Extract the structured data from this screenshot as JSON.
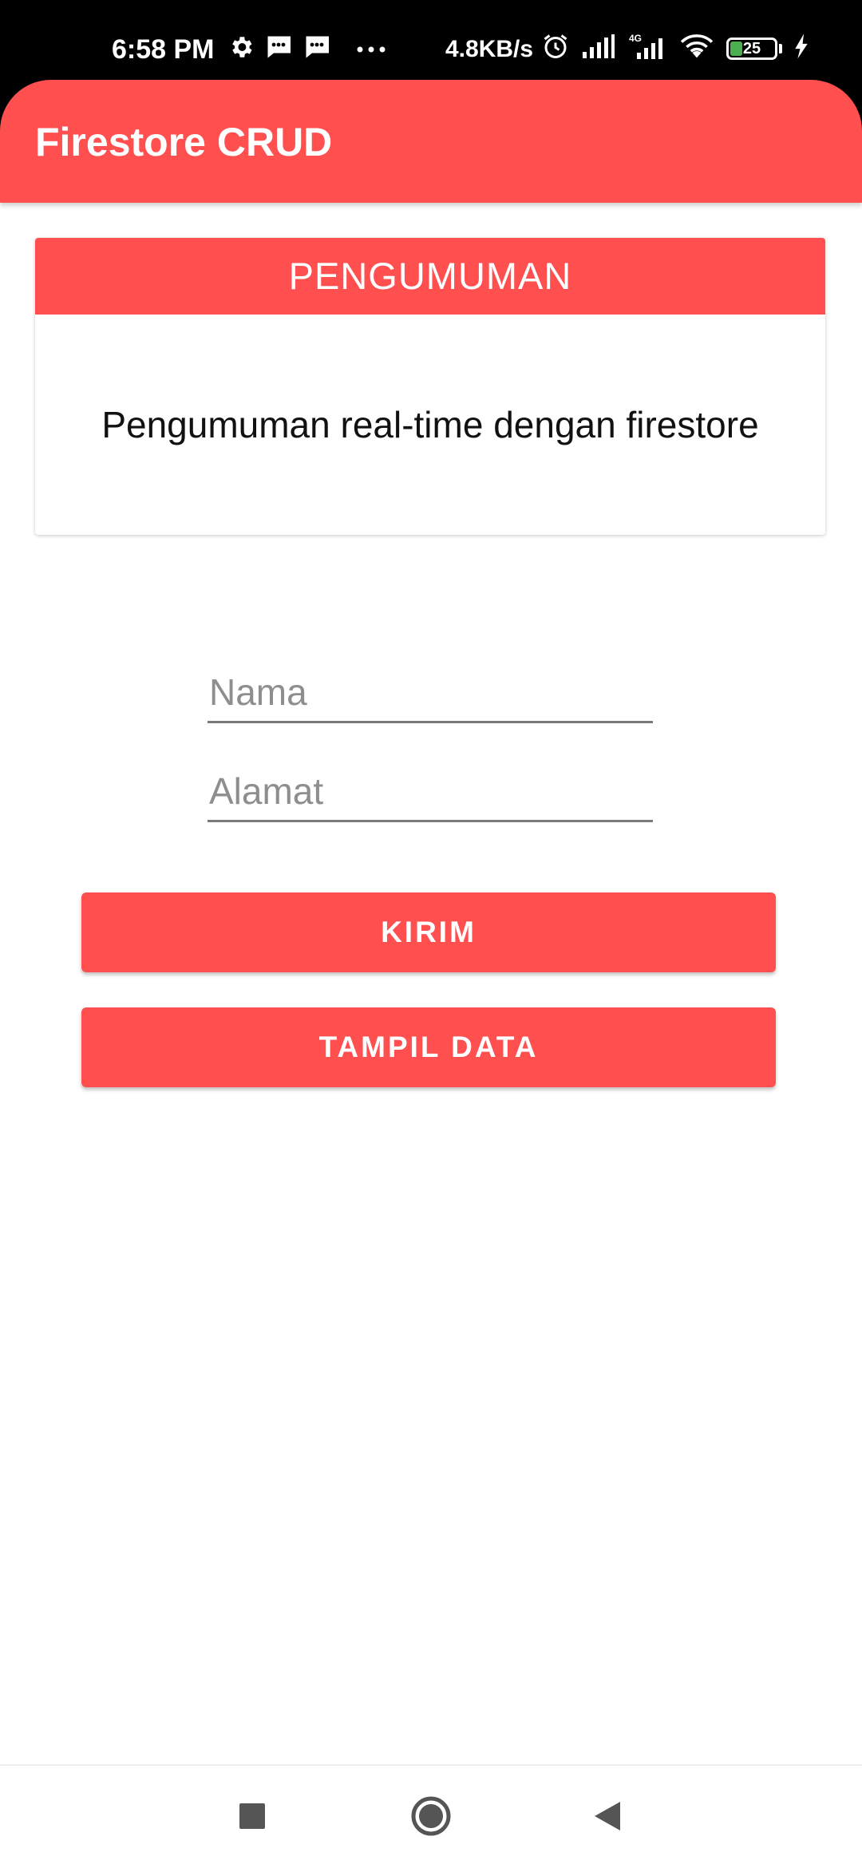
{
  "status_bar": {
    "time": "6:58 PM",
    "net_speed": "4.8KB/s",
    "battery_level": "25",
    "battery_fraction": 0.25,
    "icons": [
      "gear-icon",
      "message-icon",
      "message-icon",
      "more-dots-icon",
      "alarm-icon",
      "signal-icon",
      "signal-4g-icon",
      "wifi-icon",
      "battery-icon",
      "charging-icon"
    ]
  },
  "app_bar": {
    "title": "Firestore CRUD"
  },
  "announcement": {
    "header": "PENGUMUMAN",
    "body": "Pengumuman real-time dengan firestore"
  },
  "form": {
    "nama_placeholder": "Nama",
    "nama_value": "",
    "alamat_placeholder": "Alamat",
    "alamat_value": ""
  },
  "buttons": {
    "kirim_label": "KIRIM",
    "tampil_label": "TAMPIL DATA"
  },
  "nav": {
    "icons": [
      "recent-apps-icon",
      "home-icon",
      "back-icon"
    ]
  },
  "colors": {
    "accent": "#FF4F4F",
    "status_bar_bg": "#000000",
    "background": "#FFFFFF",
    "text": "#111111",
    "hint": "#8E8E8E"
  }
}
